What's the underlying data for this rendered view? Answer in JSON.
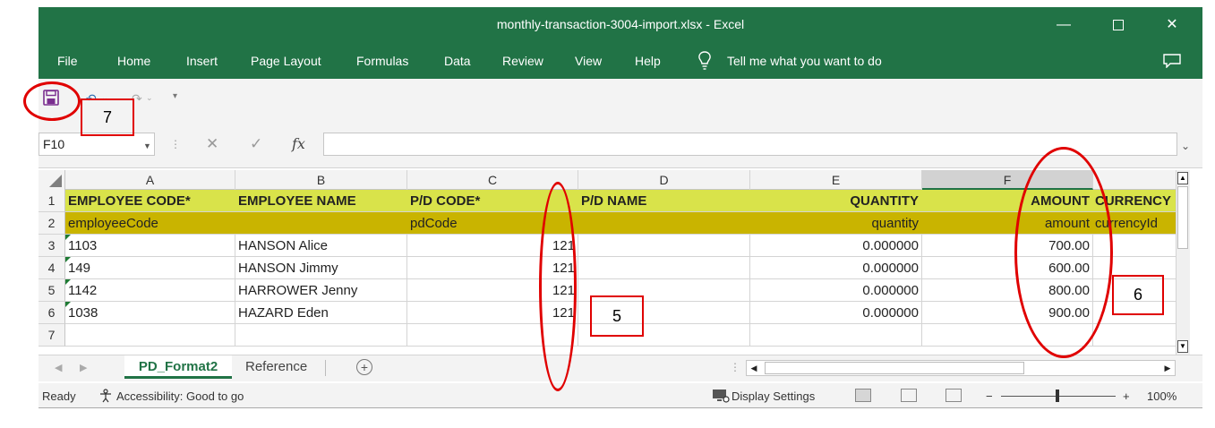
{
  "window": {
    "title": "monthly-transaction-3004-import.xlsx  -  Excel",
    "min_glyph": "—",
    "close_glyph": "✕"
  },
  "menu": {
    "items": [
      "File",
      "Home",
      "Insert",
      "Page Layout",
      "Formulas",
      "Data",
      "Review",
      "View",
      "Help"
    ],
    "tell_me": "Tell me what you want to do"
  },
  "formula_bar": {
    "name_box": "F10",
    "cancel_glyph": "✕",
    "enter_glyph": "✓",
    "fx_glyph": "fx",
    "formula": ""
  },
  "columns": [
    "A",
    "B",
    "C",
    "D",
    "E",
    "F"
  ],
  "selected_column": "F",
  "rows": [
    {
      "n": "1",
      "a": "EMPLOYEE CODE*",
      "b": "EMPLOYEE NAME",
      "c": "P/D CODE*",
      "d": "P/D NAME",
      "e": "QUANTITY",
      "f": "AMOUNT",
      "g": "CURRENCY"
    },
    {
      "n": "2",
      "a": "employeeCode",
      "b": "",
      "c": "pdCode",
      "d": "",
      "e": "quantity",
      "f": "amount",
      "g": "currencyId"
    },
    {
      "n": "3",
      "a": "1103",
      "b": "HANSON Alice",
      "c": "121",
      "d": "",
      "e": "0.000000",
      "f": "700.00",
      "g": ""
    },
    {
      "n": "4",
      "a": "149",
      "b": "HANSON Jimmy",
      "c": "121",
      "d": "",
      "e": "0.000000",
      "f": "600.00",
      "g": ""
    },
    {
      "n": "5",
      "a": "1142",
      "b": "HARROWER Jenny",
      "c": "121",
      "d": "",
      "e": "0.000000",
      "f": "800.00",
      "g": ""
    },
    {
      "n": "6",
      "a": "1038",
      "b": "HAZARD Eden",
      "c": "121",
      "d": "",
      "e": "0.000000",
      "f": "900.00",
      "g": ""
    },
    {
      "n": "7",
      "a": "",
      "b": "",
      "c": "",
      "d": "",
      "e": "",
      "f": "",
      "g": ""
    }
  ],
  "sheets": {
    "tabs": [
      "PD_Format2",
      "Reference"
    ],
    "active": "PD_Format2",
    "add_glyph": "+"
  },
  "status": {
    "ready": "Ready",
    "accessibility": "Accessibility: Good to go",
    "display_settings": "Display Settings",
    "zoom_minus": "−",
    "zoom_plus": "+",
    "zoom": "100%"
  },
  "annotations": {
    "box_5": "5",
    "box_6": "6",
    "box_7": "7"
  },
  "colors": {
    "excel_green": "#217346",
    "header_row_1": "#d9e34a",
    "header_row_2": "#c9b400",
    "annotation_red": "#e00000"
  }
}
